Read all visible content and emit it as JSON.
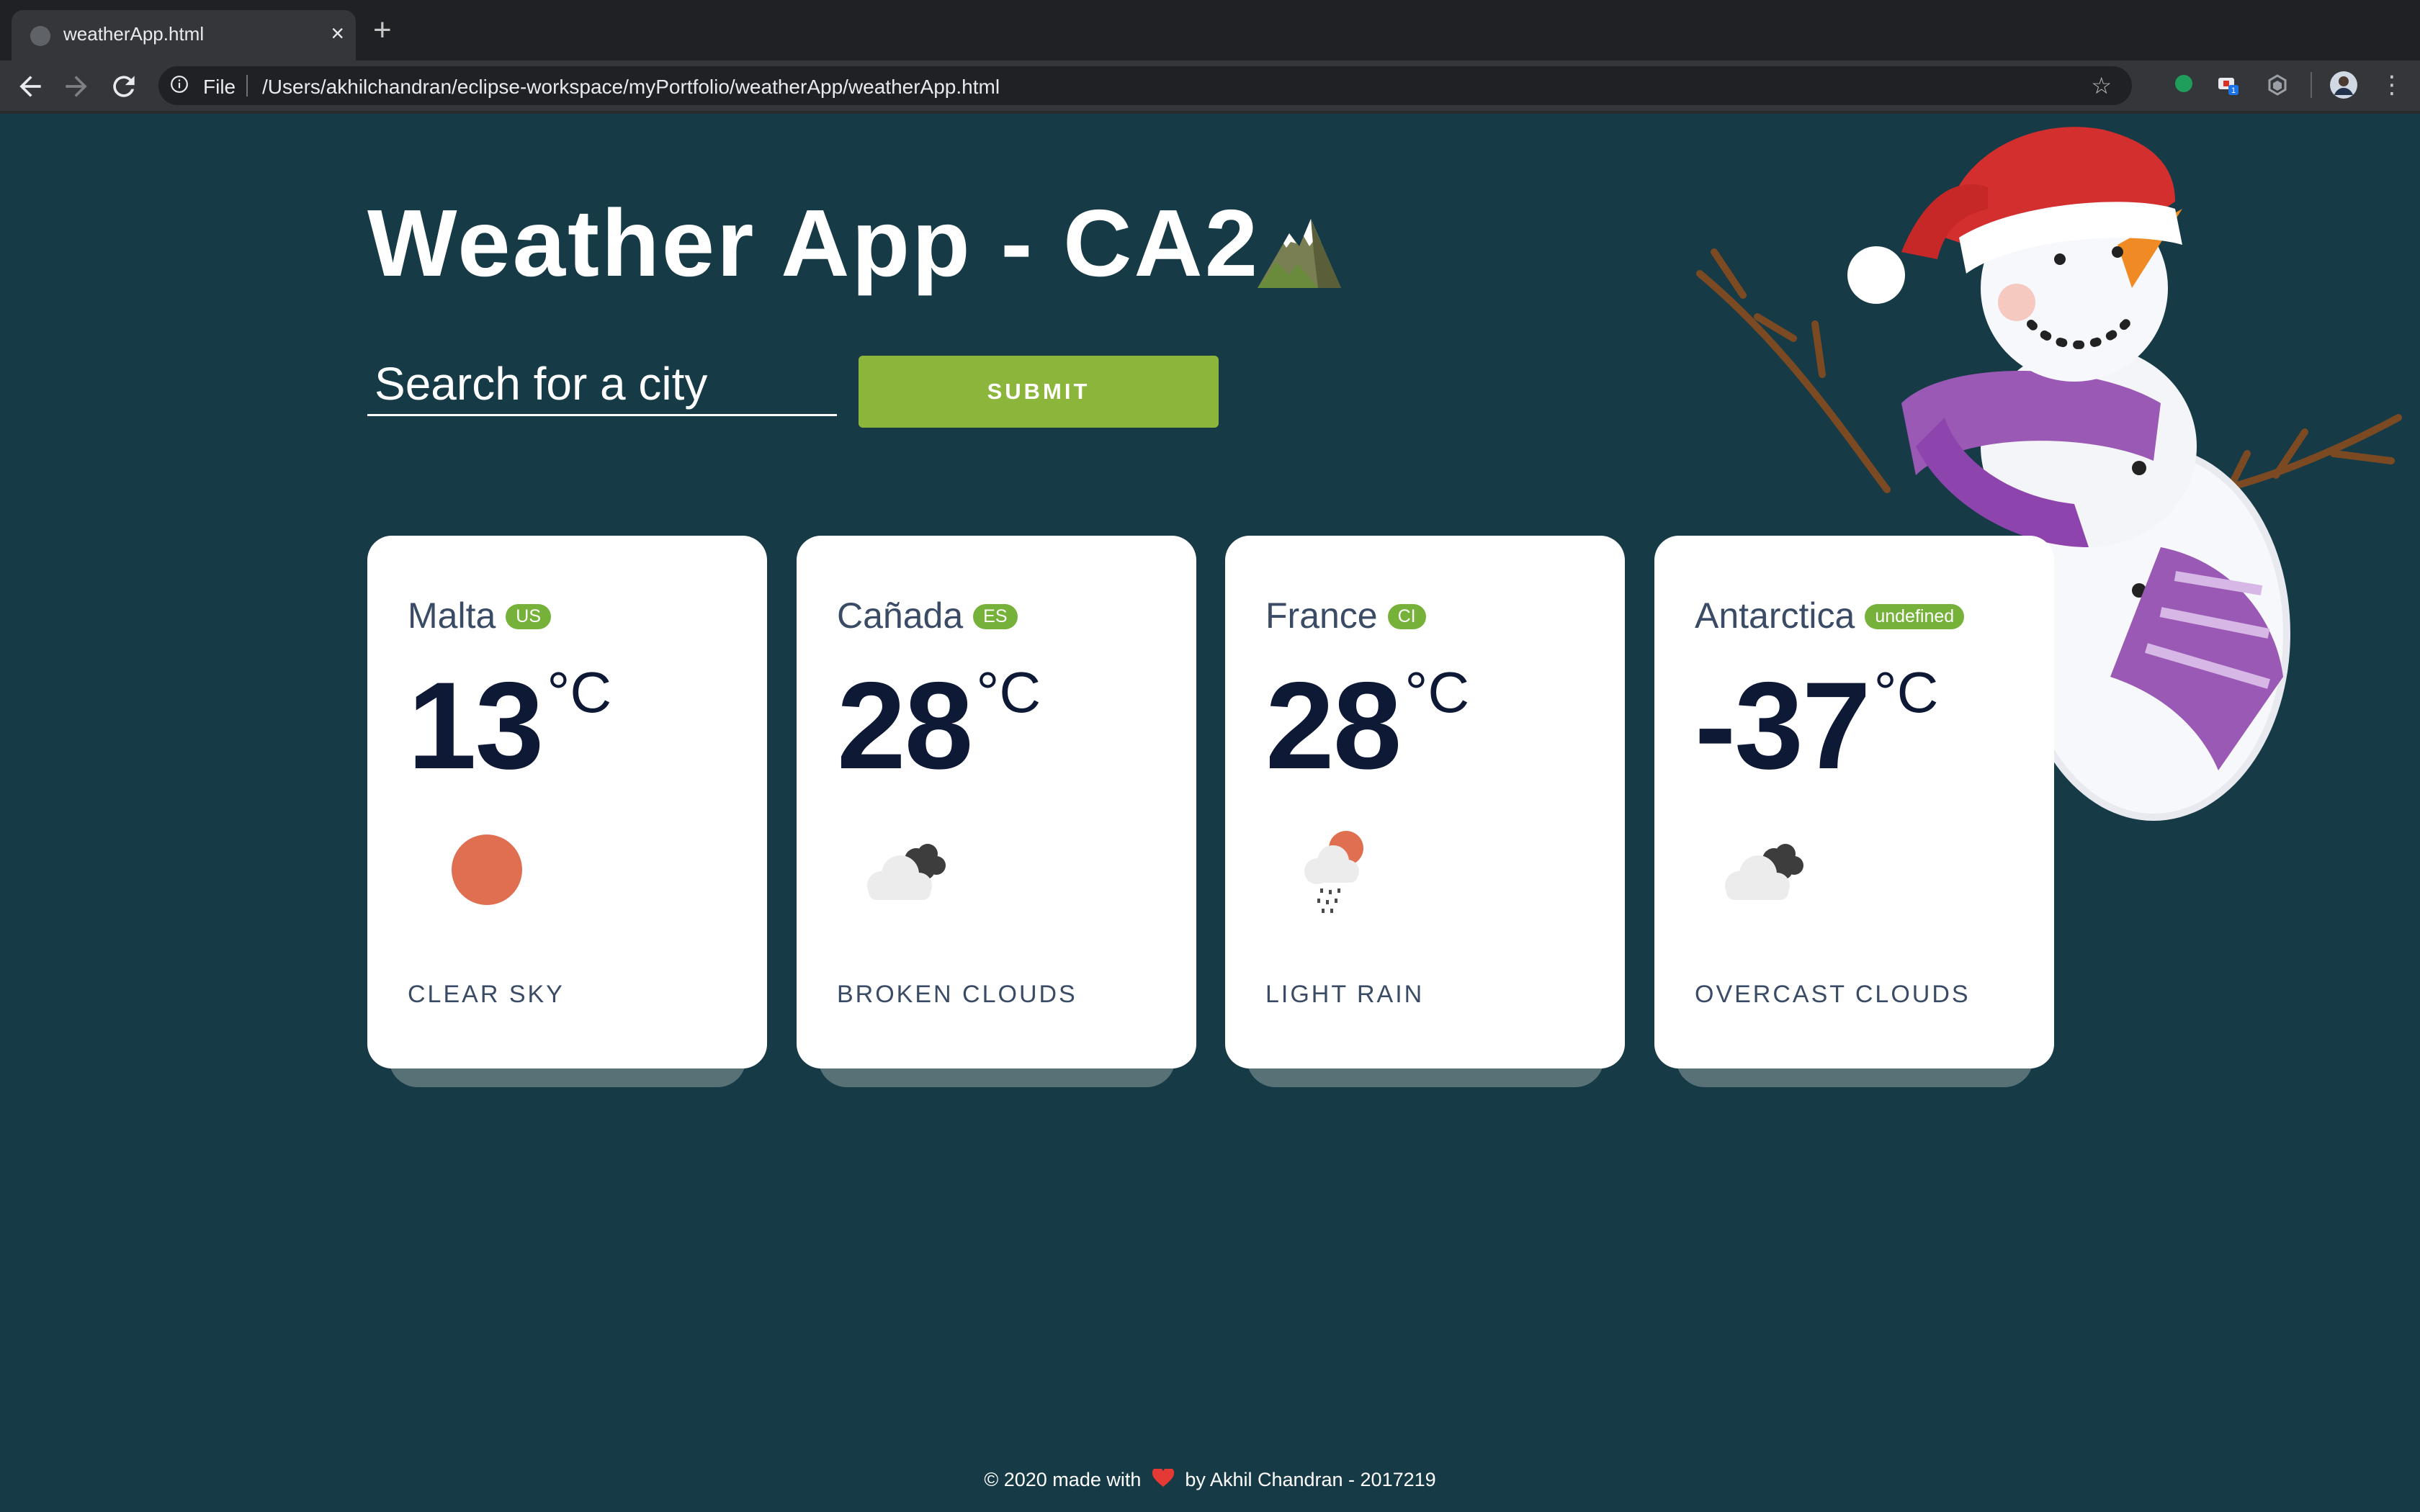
{
  "browser": {
    "tab_title": "weatherApp.html",
    "url_scheme_label": "File",
    "url_path": "/Users/akhilchandran/eclipse-workspace/myPortfolio/weatherApp/weatherApp.html",
    "extension_badge": "1"
  },
  "header": {
    "title": "Weather App - CA2"
  },
  "search": {
    "placeholder": "Search for a city",
    "value": "",
    "submit_label": "SUBMIT"
  },
  "cards": [
    {
      "city": "Malta",
      "country": "US",
      "temp": "13",
      "unit": "°C",
      "icon": "clear-sky-icon",
      "description": "CLEAR SKY"
    },
    {
      "city": "Cañada",
      "country": "ES",
      "temp": "28",
      "unit": "°C",
      "icon": "broken-clouds-icon",
      "description": "BROKEN CLOUDS"
    },
    {
      "city": "France",
      "country": "CI",
      "temp": "28",
      "unit": "°C",
      "icon": "light-rain-icon",
      "description": "LIGHT RAIN"
    },
    {
      "city": "Antarctica",
      "country": "undefined",
      "temp": "-37",
      "unit": "°C",
      "icon": "overcast-clouds-icon",
      "description": "OVERCAST CLOUDS"
    }
  ],
  "footer": {
    "prefix": "© 2020 made with",
    "suffix": "by Akhil Chandran - 2017219"
  },
  "colors": {
    "page_background": "#163a46",
    "submit_button": "#8bb53b",
    "badge": "#76b13a",
    "card_background": "#ffffff",
    "temperature_text": "#0e1935",
    "heart": "#e53935",
    "sun": "#e06f52"
  }
}
